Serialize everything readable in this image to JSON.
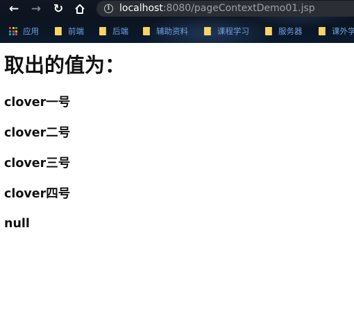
{
  "browser": {
    "url_host": "localhost",
    "url_rest": ":8080/pageContextDemo01.jsp",
    "bookmarks": [
      {
        "label": "应用",
        "icon": "apps-icon"
      },
      {
        "label": "前端",
        "icon": "folder-icon"
      },
      {
        "label": "后端",
        "icon": "folder-icon"
      },
      {
        "label": "辅助资料",
        "icon": "folder-icon"
      },
      {
        "label": "课程学习",
        "icon": "folder-icon"
      },
      {
        "label": "服务器",
        "icon": "folder-icon"
      },
      {
        "label": "课外学",
        "icon": "folder-icon"
      }
    ],
    "colors": {
      "bookmark_text": "#6f9fe0",
      "folder": "#f6d46a",
      "omnibox": "#2b2f35"
    }
  },
  "page": {
    "heading": "取出的值为：",
    "values": [
      "clover一号",
      "clover二号",
      "clover三号",
      "clover四号",
      "null"
    ]
  }
}
